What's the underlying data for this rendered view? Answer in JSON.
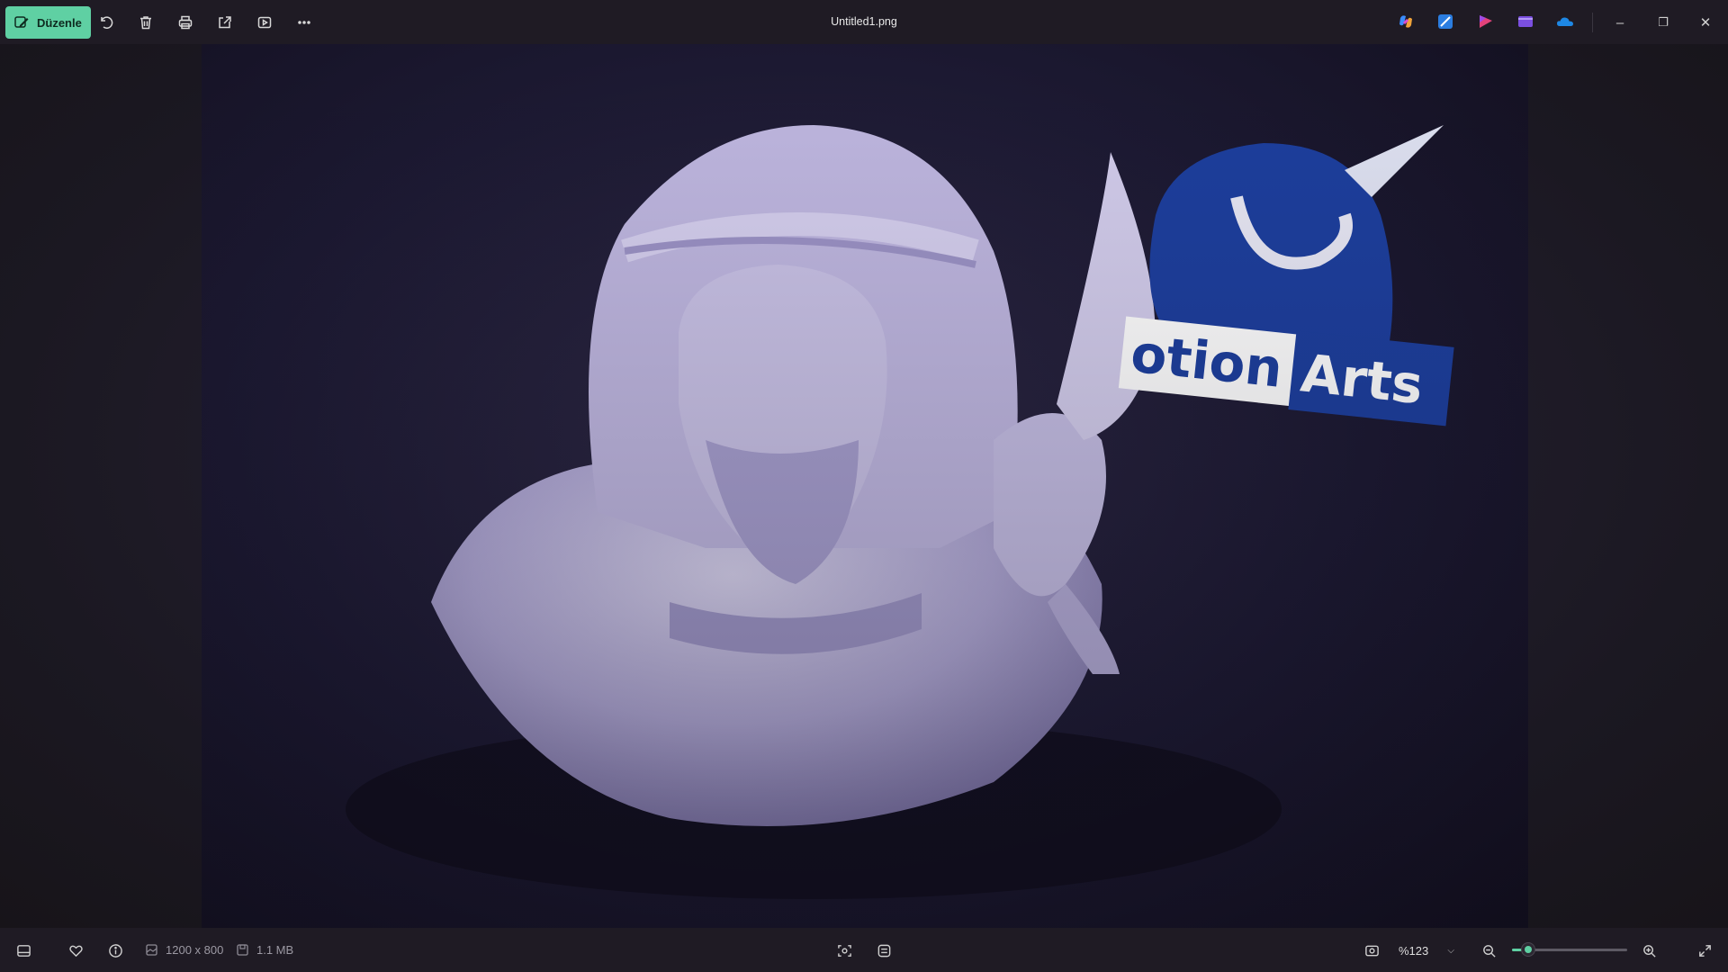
{
  "toolbar": {
    "edit_label": "Düzenle",
    "icons": [
      "rotate-icon",
      "delete-icon",
      "print-icon",
      "share-icon",
      "slideshow-icon",
      "more-icon"
    ]
  },
  "window": {
    "title": "Untitled1.png",
    "app_icons": [
      "copilot-icon",
      "designer-icon",
      "clipchamp-icon",
      "video-editor-icon",
      "onedrive-icon"
    ],
    "minimize": "–",
    "restore": "❐",
    "close": "✕"
  },
  "image": {
    "logo_text_left": "otion",
    "logo_text_right": "Arts"
  },
  "status": {
    "dimensions": "1200 x 800",
    "file_size": "1.1 MB",
    "zoom": "%123",
    "zoom_fraction": 0.14
  },
  "colors": {
    "accent": "#5fd0a3",
    "logo_blue": "#1d3f9e"
  }
}
